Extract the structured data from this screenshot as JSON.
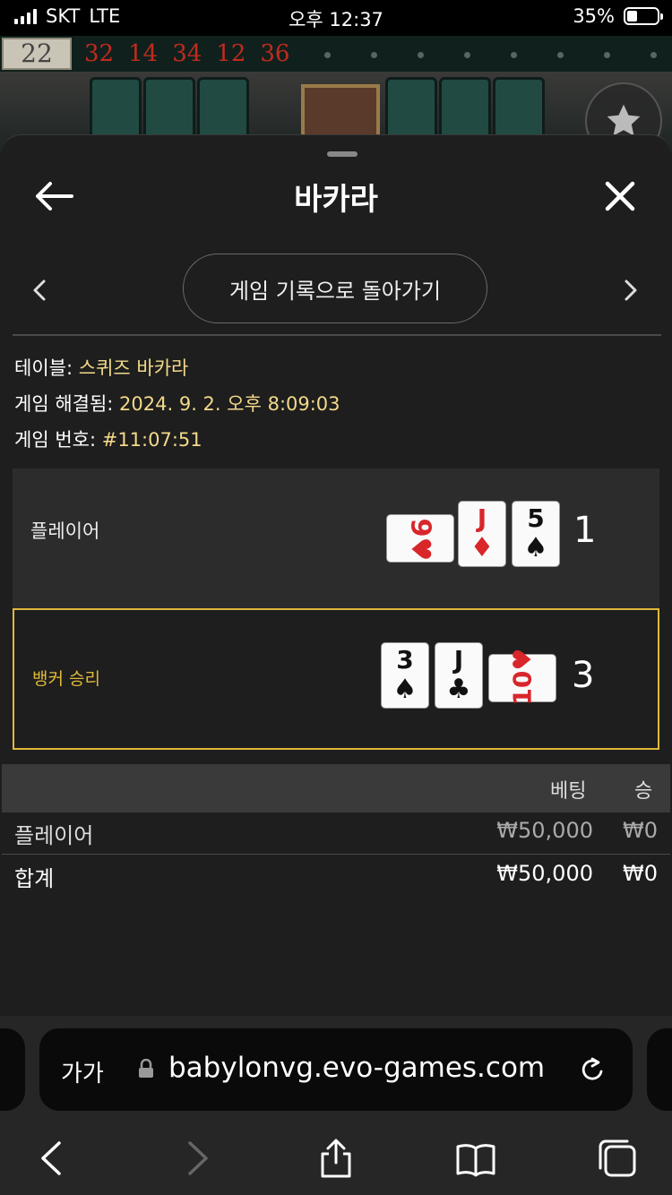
{
  "status_bar": {
    "carrier": "SKT",
    "network": "LTE",
    "time": "오후 12:37",
    "battery": "35%",
    "battery_level": 0.35
  },
  "roadmap": {
    "current": "22",
    "recent": [
      "32",
      "14",
      "34",
      "12",
      "36"
    ]
  },
  "header": {
    "title": "바카라"
  },
  "nav": {
    "return_label": "게임 기록으로 돌아가기"
  },
  "info": {
    "table_label": "테이블:",
    "table_value": "스퀴즈 바카라",
    "resolved_label": "게임 해결됨:",
    "resolved_value": "2024. 9. 2. 오후 8:09:03",
    "game_no_label": "게임 번호:",
    "game_no_value": "#11:07:51"
  },
  "hands": {
    "player": {
      "label": "플레이어",
      "score": "1",
      "cards": [
        {
          "rank": "9",
          "suit": "♥",
          "orientation": "sideways"
        },
        {
          "rank": "J",
          "suit": "♦"
        },
        {
          "rank": "5",
          "suit": "♠"
        }
      ]
    },
    "banker": {
      "label": "뱅커 승리",
      "score": "3",
      "cards": [
        {
          "rank": "3",
          "suit": "♠"
        },
        {
          "rank": "J",
          "suit": "♣"
        },
        {
          "rank": "10",
          "suit": "♥",
          "orientation": "sideways"
        }
      ]
    }
  },
  "bets_table": {
    "columns": [
      "베팅",
      "승"
    ],
    "rows": [
      {
        "name": "플레이어",
        "bet": "₩50,000",
        "win": "₩0"
      }
    ],
    "total": {
      "name": "합계",
      "bet": "₩50,000",
      "win": "₩0"
    }
  },
  "browser": {
    "aa": "가가",
    "url": "babylonvg.evo-games.com"
  },
  "colors": {
    "accent": "#e0b93a",
    "info_value": "#f2d98a",
    "red_suit": "#d8262b",
    "road_red": "#c02b1f"
  }
}
